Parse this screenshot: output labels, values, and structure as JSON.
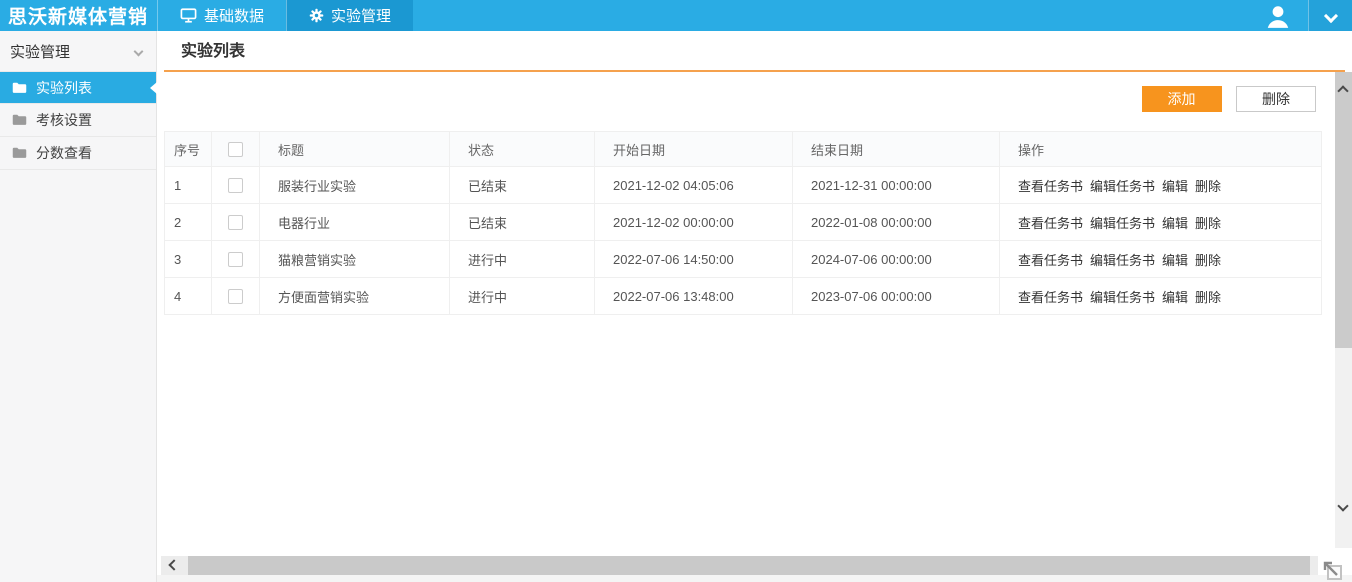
{
  "topbar": {
    "logo": "思沃新媒体营销",
    "tabs": [
      {
        "label": "基础数据",
        "icon": "monitor-icon",
        "active": false
      },
      {
        "label": "实验管理",
        "icon": "gear-icon",
        "active": true
      }
    ]
  },
  "sidebar": {
    "group_label": "实验管理",
    "items": [
      {
        "label": "实验列表",
        "active": true
      },
      {
        "label": "考核设置",
        "active": false
      },
      {
        "label": "分数查看",
        "active": false
      }
    ]
  },
  "main": {
    "title": "实验列表",
    "toolbar": {
      "add_label": "添加",
      "delete_label": "删除"
    },
    "table": {
      "headers": {
        "no": "序号",
        "title": "标题",
        "status": "状态",
        "start": "开始日期",
        "end": "结束日期",
        "ops": "操作"
      },
      "actions": [
        "查看任务书",
        "编辑任务书",
        "编辑",
        "删除"
      ],
      "rows": [
        {
          "no": "1",
          "title": "服装行业实验",
          "status": "已结束",
          "start": "2021-12-02 04:05:06",
          "end": "2021-12-31 00:00:00"
        },
        {
          "no": "2",
          "title": "电器行业",
          "status": "已结束",
          "start": "2021-12-02 00:00:00",
          "end": "2022-01-08 00:00:00"
        },
        {
          "no": "3",
          "title": "猫粮营销实验",
          "status": "进行中",
          "start": "2022-07-06 14:50:00",
          "end": "2024-07-06 00:00:00"
        },
        {
          "no": "4",
          "title": "方便面营销实验",
          "status": "进行中",
          "start": "2022-07-06 13:48:00",
          "end": "2023-07-06 00:00:00"
        }
      ]
    }
  },
  "colors": {
    "topbar_blue": "#2aace4",
    "active_tab_blue": "#1b98d2",
    "active_item_blue": "#29abe2",
    "accent_orange": "#f7941e",
    "divider_orange": "#f5a14d"
  }
}
